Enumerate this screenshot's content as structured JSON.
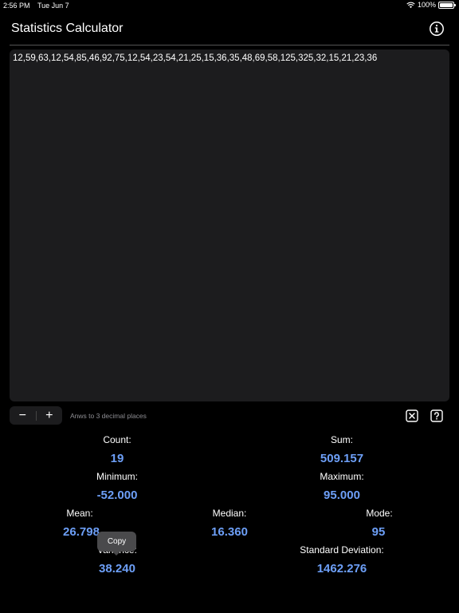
{
  "status_bar": {
    "time": "2:56 PM",
    "date": "Tue Jun 7",
    "battery": "100%"
  },
  "nav": {
    "title": "Statistics Calculator",
    "info_icon": "info-circle-icon"
  },
  "input": {
    "text": "12,59,63,12,54,85,46,92,75,12,54,23,54,21,25,15,36,35,48,69,58,125,325,32,15,21,23,36"
  },
  "toolbar": {
    "decrement_label": "−",
    "increment_label": "+",
    "precision_label": "Anws to 3 decimal places",
    "clear_icon": "clear-x-icon",
    "help_icon": "question-mark-icon"
  },
  "stats": {
    "count_label": "Count:",
    "count_value": "19",
    "sum_label": "Sum:",
    "sum_value": "509.157",
    "minimum_label": "Minimum:",
    "minimum_value": "-52.000",
    "maximum_label": "Maximum:",
    "maximum_value": "95.000",
    "mean_label": "Mean:",
    "mean_value": "26.798",
    "median_label": "Median:",
    "median_value": "16.360",
    "mode_label": "Mode:",
    "mode_value": "95",
    "variance_label": "Variance:",
    "variance_value": "38.240",
    "std_dev_label": "Standard Deviation:",
    "std_dev_value": "1462.276"
  },
  "tooltip": {
    "copy_label": "Copy"
  },
  "colors": {
    "accent": "#6d9ff7",
    "background": "#000000",
    "surface": "#1c1c1e"
  }
}
